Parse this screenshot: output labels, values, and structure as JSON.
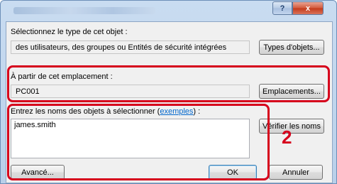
{
  "dialog": {
    "help_glyph": "?",
    "close_glyph": "x"
  },
  "object_type": {
    "label": "Sélectionnez le type de cet objet :",
    "value": "des utilisateurs, des groupes ou Entités de sécurité intégrées",
    "button": "Types d'objets..."
  },
  "location": {
    "label": "À partir de cet emplacement :",
    "value": "PC001",
    "button": "Emplacements..."
  },
  "names": {
    "label_prefix": "Entrez les noms des objets à sélectionner (",
    "examples_link": "exemples",
    "label_suffix": ") :",
    "value": "james.smith",
    "check_button": "Vérifier les noms"
  },
  "footer": {
    "advanced_button": "Avancé...",
    "ok_button": "OK",
    "cancel_button": "Annuler"
  },
  "annotation": {
    "step_number": "2",
    "color": "#d6001c"
  }
}
